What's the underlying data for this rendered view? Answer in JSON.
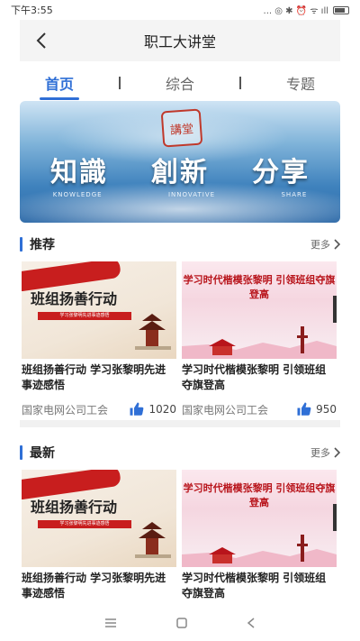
{
  "status_bar": {
    "time": "下午3:55",
    "icons": "... ◎ ✱ ⏰ ᯤ ıll"
  },
  "nav": {
    "title": "职工大讲堂"
  },
  "tabs": [
    {
      "label": "首页",
      "active": true
    },
    {
      "label": "综合",
      "active": false
    },
    {
      "label": "专题",
      "active": false
    }
  ],
  "banner": {
    "seal_text": "講堂",
    "words": [
      "知識",
      "創新",
      "分享"
    ],
    "subtitles": [
      "KNOWLEDGE",
      "INNOVATIVE",
      "SHARE"
    ]
  },
  "recommended": {
    "title": "推荐",
    "more": "更多",
    "items": [
      {
        "title": "班组扬善行动 学习张黎明先进事迹感悟",
        "source": "国家电网公司工会",
        "likes": "1020",
        "thumb": {
          "heading": "班组扬善行动",
          "bar_text": "学习张黎明先进事迹感悟"
        }
      },
      {
        "title": "学习时代楷模张黎明 引领班组夺旗登高",
        "source": "国家电网公司工会",
        "likes": "950",
        "thumb": {
          "heading": "学习时代楷模张黎明 引领班组夺旗登高"
        }
      }
    ]
  },
  "latest": {
    "title": "最新",
    "more": "更多",
    "items": [
      {
        "title": "班组扬善行动 学习张黎明先进事迹感悟",
        "thumb": {
          "heading": "班组扬善行动",
          "bar_text": "学习张黎明先进事迹感悟"
        }
      },
      {
        "title": "学习时代楷模张黎明 引领班组夺旗登高",
        "thumb": {
          "heading": "学习时代楷模张黎明 引领班组夺旗登高"
        }
      }
    ]
  },
  "colors": {
    "accent": "#2f6fd6",
    "ribbon_red": "#c81e1e"
  }
}
